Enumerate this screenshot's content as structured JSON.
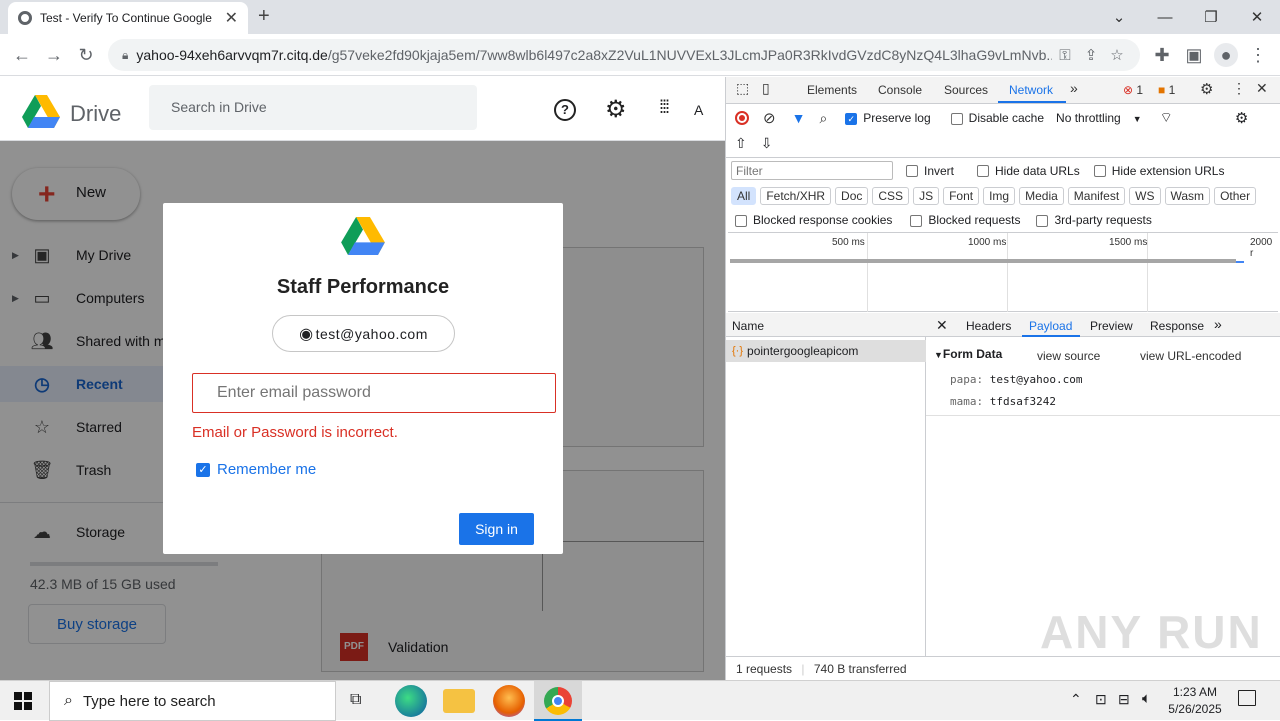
{
  "browser": {
    "tab_title": "Test - Verify To Continue Google",
    "url_host": "yahoo-94xeh6arvvqm7r.citq.de",
    "url_path": "/g57veke2fd90kjaja5em/7ww8wlb6l497c2a8xZ2VuL1NUVVExL3JLcmJPa0R3RkIvdGVzdC8yNzQ4L3lhaG9vLmNvb..."
  },
  "drive": {
    "logo_text": "Drive",
    "search_placeholder": "Search in Drive",
    "account_initial": "A",
    "new_label": "New",
    "sidebar": [
      {
        "label": "My Drive",
        "icon": "my-drive-icon"
      },
      {
        "label": "Computers",
        "icon": "computer-icon"
      },
      {
        "label": "Shared with me",
        "icon": "shared-icon"
      },
      {
        "label": "Recent",
        "icon": "clock-icon"
      },
      {
        "label": "Starred",
        "icon": "star-icon"
      },
      {
        "label": "Trash",
        "icon": "trash-icon"
      },
      {
        "label": "Storage",
        "icon": "cloud-icon"
      }
    ],
    "storage_text": "42.3 MB of 15 GB used",
    "buy_storage": "Buy storage",
    "file_name": "Validation"
  },
  "modal": {
    "title": "Staff Performance",
    "account_email": "test@yahoo.com",
    "password_placeholder": "Enter email password",
    "error_text": "Email or Password is incorrect.",
    "remember_label": "Remember me",
    "signin_label": "Sign in"
  },
  "devtools": {
    "tabs": [
      "Elements",
      "Console",
      "Sources",
      "Network"
    ],
    "errors_count": "1",
    "warnings_count": "1",
    "preserve_log": "Preserve log",
    "disable_cache": "Disable cache",
    "throttling": "No throttling",
    "filter_placeholder": "Filter",
    "invert": "Invert",
    "hide_data_urls": "Hide data URLs",
    "hide_extension_urls": "Hide extension URLs",
    "type_filters": [
      "All",
      "Fetch/XHR",
      "Doc",
      "CSS",
      "JS",
      "Font",
      "Img",
      "Media",
      "Manifest",
      "WS",
      "Wasm",
      "Other"
    ],
    "blocked_cookies": "Blocked response cookies",
    "blocked_requests": "Blocked requests",
    "third_party": "3rd-party requests",
    "ticks": [
      "500 ms",
      "1000 ms",
      "1500 ms",
      "2000 r"
    ],
    "name_header": "Name",
    "request_name": "pointergoogleapicom",
    "detail_tabs": [
      "Headers",
      "Payload",
      "Preview",
      "Response"
    ],
    "form_data_label": "Form Data",
    "view_source": "view source",
    "view_url_encoded": "view URL-encoded",
    "form_rows": [
      {
        "key": "papa:",
        "value": "test@yahoo.com"
      },
      {
        "key": "mama:",
        "value": "tfdsaf3242"
      }
    ],
    "requests_summary": "1 requests",
    "transferred": "740 B transferred"
  },
  "taskbar": {
    "search_text": "Type here to search",
    "time": "1:23 AM",
    "date": "5/26/2025"
  },
  "watermark": "ANY RUN"
}
